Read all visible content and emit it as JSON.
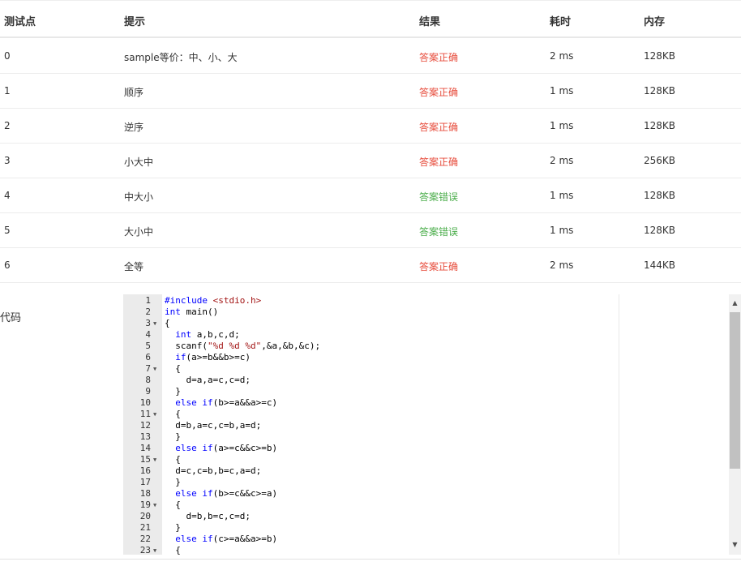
{
  "table": {
    "headers": [
      "测试点",
      "提示",
      "结果",
      "耗时",
      "内存"
    ],
    "rows": [
      {
        "id": "0",
        "hint": "sample等价：中、小、大",
        "result": "答案正确",
        "status": "correct",
        "time": "2 ms",
        "memory": "128KB"
      },
      {
        "id": "1",
        "hint": "顺序",
        "result": "答案正确",
        "status": "correct",
        "time": "1 ms",
        "memory": "128KB"
      },
      {
        "id": "2",
        "hint": "逆序",
        "result": "答案正确",
        "status": "correct",
        "time": "1 ms",
        "memory": "128KB"
      },
      {
        "id": "3",
        "hint": "小大中",
        "result": "答案正确",
        "status": "correct",
        "time": "2 ms",
        "memory": "256KB"
      },
      {
        "id": "4",
        "hint": "中大小",
        "result": "答案错误",
        "status": "wrong",
        "time": "1 ms",
        "memory": "128KB"
      },
      {
        "id": "5",
        "hint": "大小中",
        "result": "答案错误",
        "status": "wrong",
        "time": "1 ms",
        "memory": "128KB"
      },
      {
        "id": "6",
        "hint": "全等",
        "result": "答案正确",
        "status": "correct",
        "time": "2 ms",
        "memory": "144KB"
      }
    ]
  },
  "colors": {
    "correct": "#e74c3c",
    "wrong": "#4cae4c"
  },
  "code_label": "代码",
  "editor": {
    "lines": [
      {
        "n": "1",
        "fold": false,
        "text": "#include <stdio.h>"
      },
      {
        "n": "2",
        "fold": false,
        "text": "int main()"
      },
      {
        "n": "3",
        "fold": true,
        "text": "{"
      },
      {
        "n": "4",
        "fold": false,
        "text": "  int a,b,c,d;"
      },
      {
        "n": "5",
        "fold": false,
        "text": "  scanf(\"%d %d %d\",&a,&b,&c);"
      },
      {
        "n": "6",
        "fold": false,
        "text": "  if(a>=b&&b>=c)"
      },
      {
        "n": "7",
        "fold": true,
        "text": "  {"
      },
      {
        "n": "8",
        "fold": false,
        "text": "    d=a,a=c,c=d;"
      },
      {
        "n": "9",
        "fold": false,
        "text": "  }"
      },
      {
        "n": "10",
        "fold": false,
        "text": "  else if(b>=a&&a>=c)"
      },
      {
        "n": "11",
        "fold": true,
        "text": "  {"
      },
      {
        "n": "12",
        "fold": false,
        "text": "  d=b,a=c,c=b,a=d;"
      },
      {
        "n": "13",
        "fold": false,
        "text": "  }"
      },
      {
        "n": "14",
        "fold": false,
        "text": "  else if(a>=c&&c>=b)"
      },
      {
        "n": "15",
        "fold": true,
        "text": "  {"
      },
      {
        "n": "16",
        "fold": false,
        "text": "  d=c,c=b,b=c,a=d;"
      },
      {
        "n": "17",
        "fold": false,
        "text": "  }"
      },
      {
        "n": "18",
        "fold": false,
        "text": "  else if(b>=c&&c>=a)"
      },
      {
        "n": "19",
        "fold": true,
        "text": "  {"
      },
      {
        "n": "20",
        "fold": false,
        "text": "    d=b,b=c,c=d;"
      },
      {
        "n": "21",
        "fold": false,
        "text": "  }"
      },
      {
        "n": "22",
        "fold": false,
        "text": "  else if(c>=a&&a>=b)"
      },
      {
        "n": "23",
        "fold": true,
        "text": "  {"
      }
    ]
  },
  "icons": {
    "fold": "triangle-down",
    "scroll_up": "triangle-up",
    "scroll_down": "triangle-down"
  }
}
